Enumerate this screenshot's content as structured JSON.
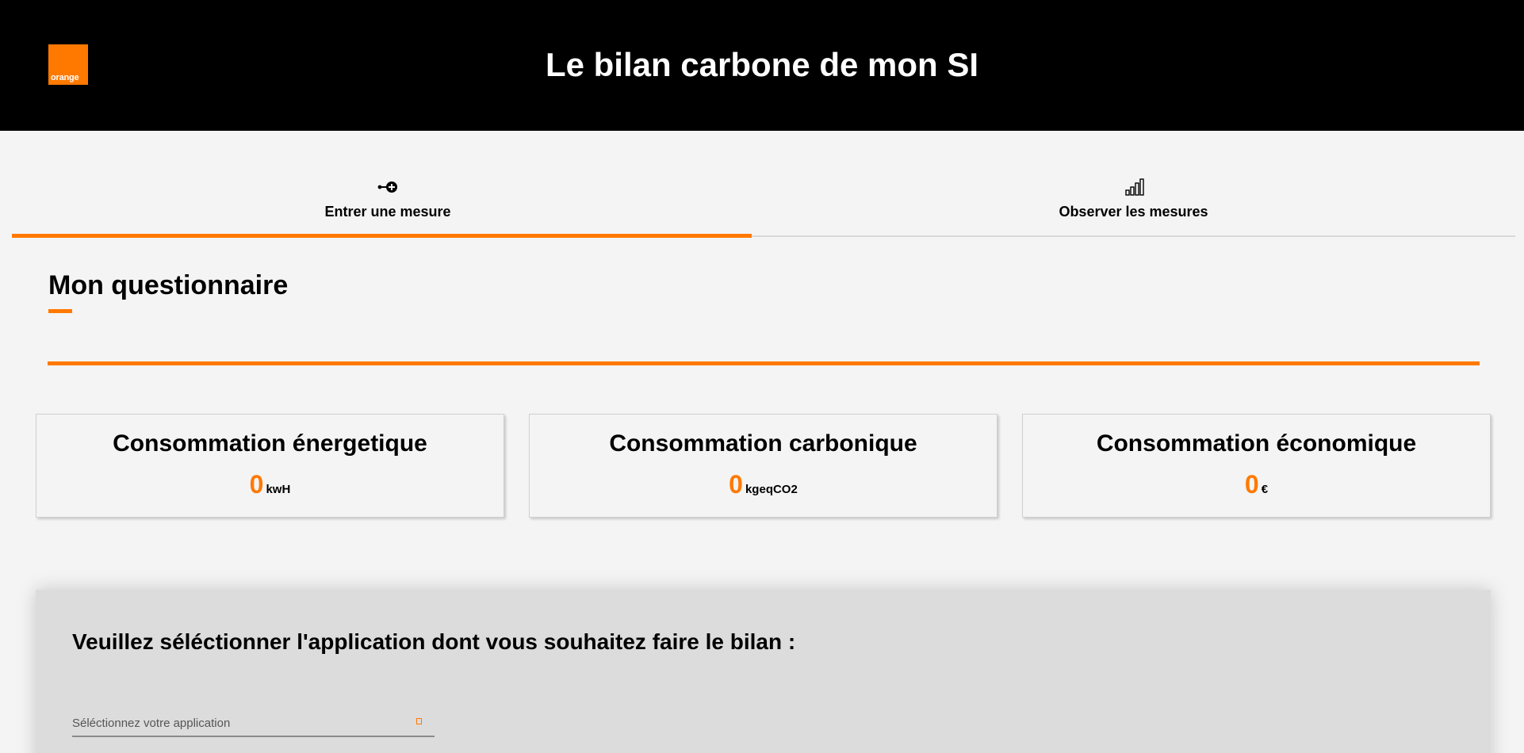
{
  "header": {
    "title": "Le bilan carbone de mon SI",
    "logo_text": "orange",
    "brand_color": "#ff7900"
  },
  "tabs": [
    {
      "label": "Entrer une mesure",
      "icon": "add-measure-icon",
      "active": true
    },
    {
      "label": "Observer les mesures",
      "icon": "bar-chart-icon",
      "active": false
    }
  ],
  "section": {
    "title": "Mon questionnaire"
  },
  "cards": [
    {
      "title": "Consommation énergetique",
      "value": "0",
      "unit": "kwH"
    },
    {
      "title": "Consommation carbonique",
      "value": "0",
      "unit": "kgeqCO2"
    },
    {
      "title": "Consommation économique",
      "value": "0",
      "unit": "€"
    }
  ],
  "panel": {
    "question": "Veuillez séléctionner l'application dont vous souhaitez faire le bilan :",
    "select_placeholder": "Séléctionnez votre application",
    "select_icon": "dropdown-icon"
  }
}
